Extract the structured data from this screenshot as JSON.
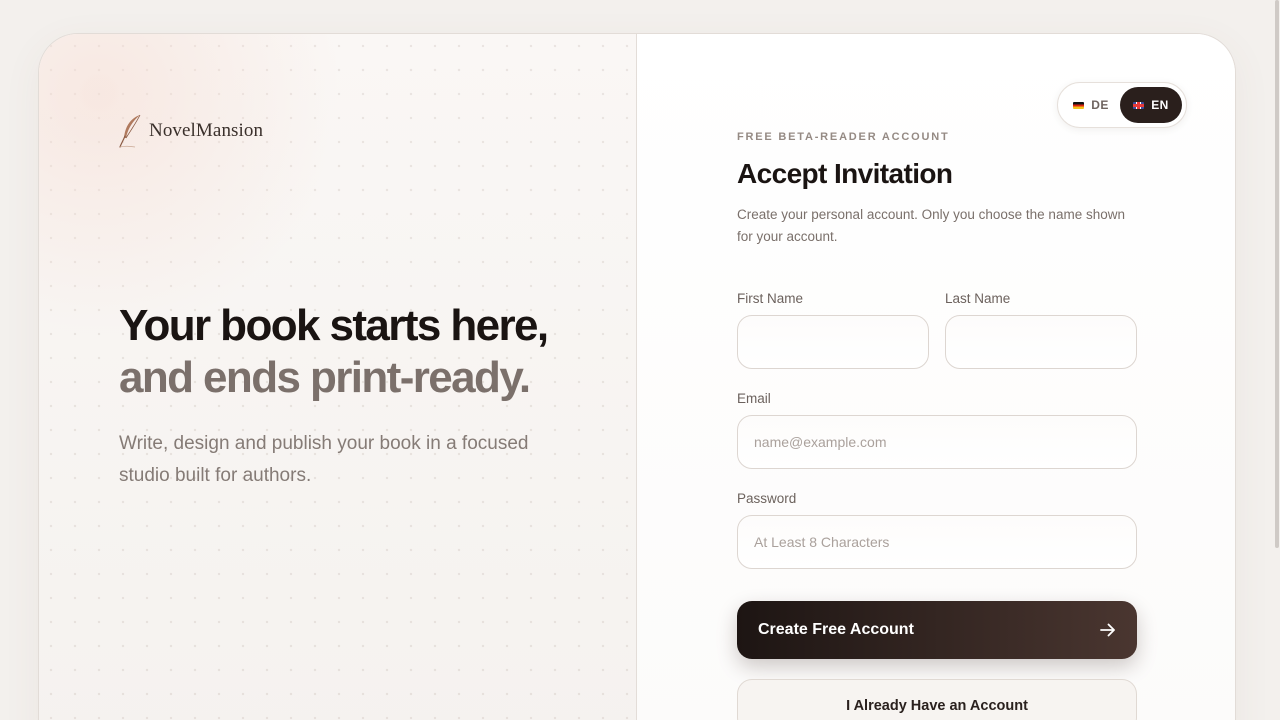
{
  "brand": {
    "name": "NovelMansion",
    "icon": "feather-quill-icon"
  },
  "hero": {
    "headline_line1": "Your book starts here,",
    "headline_line2": "and ends print-ready.",
    "subtext": "Write, design and publish your book in a focused studio built for authors."
  },
  "language": {
    "options": [
      {
        "code": "DE",
        "flag": "flag-de-icon",
        "active": false
      },
      {
        "code": "EN",
        "flag": "flag-uk-icon",
        "active": true
      }
    ]
  },
  "form": {
    "eyebrow": "FREE BETA-READER ACCOUNT",
    "title": "Accept Invitation",
    "description": "Create your personal account. Only you choose the name shown for your account.",
    "fields": {
      "first_name": {
        "label": "First Name",
        "value": "",
        "placeholder": ""
      },
      "last_name": {
        "label": "Last Name",
        "value": "",
        "placeholder": ""
      },
      "email": {
        "label": "Email",
        "value": "",
        "placeholder": "name@example.com"
      },
      "password": {
        "label": "Password",
        "value": "",
        "placeholder": "At Least 8 Characters"
      }
    },
    "submit_label": "Create Free Account",
    "submit_icon": "arrow-right-icon",
    "secondary_label": "I Already Have an Account"
  },
  "colors": {
    "primary_dark": "#1d1513",
    "primary_gradient_end": "#4a3630",
    "muted_text": "#7b706b",
    "accent_feather": "#b07a5e"
  }
}
